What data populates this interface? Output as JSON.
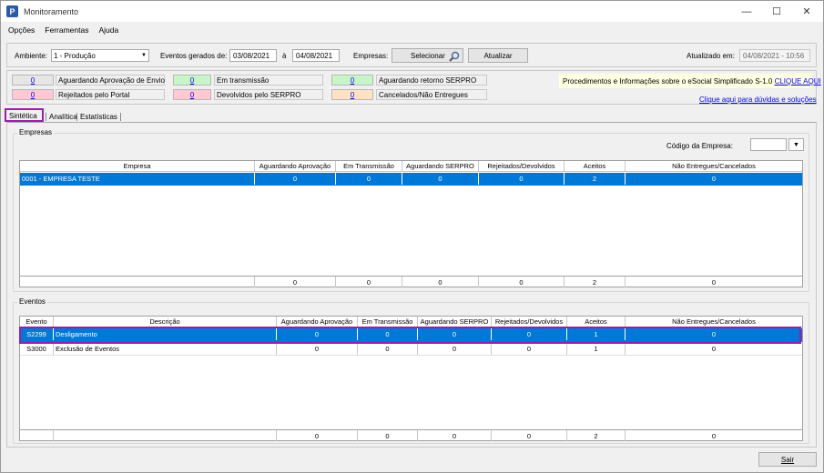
{
  "window": {
    "title": "Monitoramento",
    "app_icon": "P",
    "minimize": "—",
    "maximize": "☐",
    "close": "✕"
  },
  "menu": [
    "Opções",
    "Ferramentas",
    "Ajuda"
  ],
  "toolbar": {
    "ambiente_label": "Ambiente:",
    "ambiente_value": "1 - Produção",
    "eventos_label": "Eventos gerados de:",
    "date_from": "03/08/2021",
    "a_label": "à",
    "date_to": "04/08/2021",
    "empresas_label": "Empresas:",
    "selecionar": "Selecionar",
    "atualizar": "Atualizar",
    "atualizado_label": "Atualizado em:",
    "atualizado_value": "04/08/2021 - 10:56"
  },
  "status": [
    {
      "count": "0",
      "label": "Aguardando Aprovação de Envio",
      "color": "#e6e6e6"
    },
    {
      "count": "0",
      "label": "Em transmissão",
      "color": "#c8f5c8"
    },
    {
      "count": "0",
      "label": "Aguardando retorno SERPRO",
      "color": "#c8f5c8"
    },
    {
      "count": "0",
      "label": "Rejeitados pelo Portal",
      "color": "#ffc8d2"
    },
    {
      "count": "0",
      "label": "Devolvidos pelo SERPRO",
      "color": "#ffc8d2"
    },
    {
      "count": "0",
      "label": "Cancelados/Não Entregues",
      "color": "#ffe1c3"
    }
  ],
  "info": {
    "text": "Procedimentos e Informações sobre o eSocial Simplificado S-1.0",
    "link": "CLIQUE AQUI",
    "help_link": "Clique aqui para dúvidas e soluções"
  },
  "tabs": [
    "Sintética",
    "Analítica",
    "Estatísticas"
  ],
  "empresas": {
    "title": "Empresas",
    "codigo_label": "Código da Empresa:",
    "columns": [
      "Empresa",
      "Aguardando Aprovação",
      "Em Transmissão",
      "Aguardando SERPRO",
      "Rejeitados/Devolvidos",
      "Aceitos",
      "Não Entregues/Cancelados"
    ],
    "rows": [
      [
        "0001 - EMPRESA TESTE",
        "0",
        "0",
        "0",
        "0",
        "2",
        "0"
      ]
    ],
    "totals": [
      "",
      "0",
      "0",
      "0",
      "0",
      "2",
      "0"
    ]
  },
  "eventos": {
    "title": "Eventos",
    "columns": [
      "Evento",
      "Descrição",
      "Aguardando Aprovação",
      "Em Transmissão",
      "Aguardando SERPRO",
      "Rejeitados/Devolvidos",
      "Aceitos",
      "Não Entregues/Cancelados"
    ],
    "rows": [
      [
        "S2299",
        "Desligamento",
        "0",
        "0",
        "0",
        "0",
        "1",
        "0"
      ],
      [
        "S3000",
        "Exclusão de Eventos",
        "0",
        "0",
        "0",
        "0",
        "1",
        "0"
      ]
    ],
    "totals": [
      "",
      "",
      "0",
      "0",
      "0",
      "0",
      "2",
      "0"
    ]
  },
  "sair": "Sair",
  "colors": {
    "selection": "#0078d7",
    "highlight": "#9b1fa4",
    "link": "#0000ff",
    "info_bg": "#ffffe1"
  }
}
